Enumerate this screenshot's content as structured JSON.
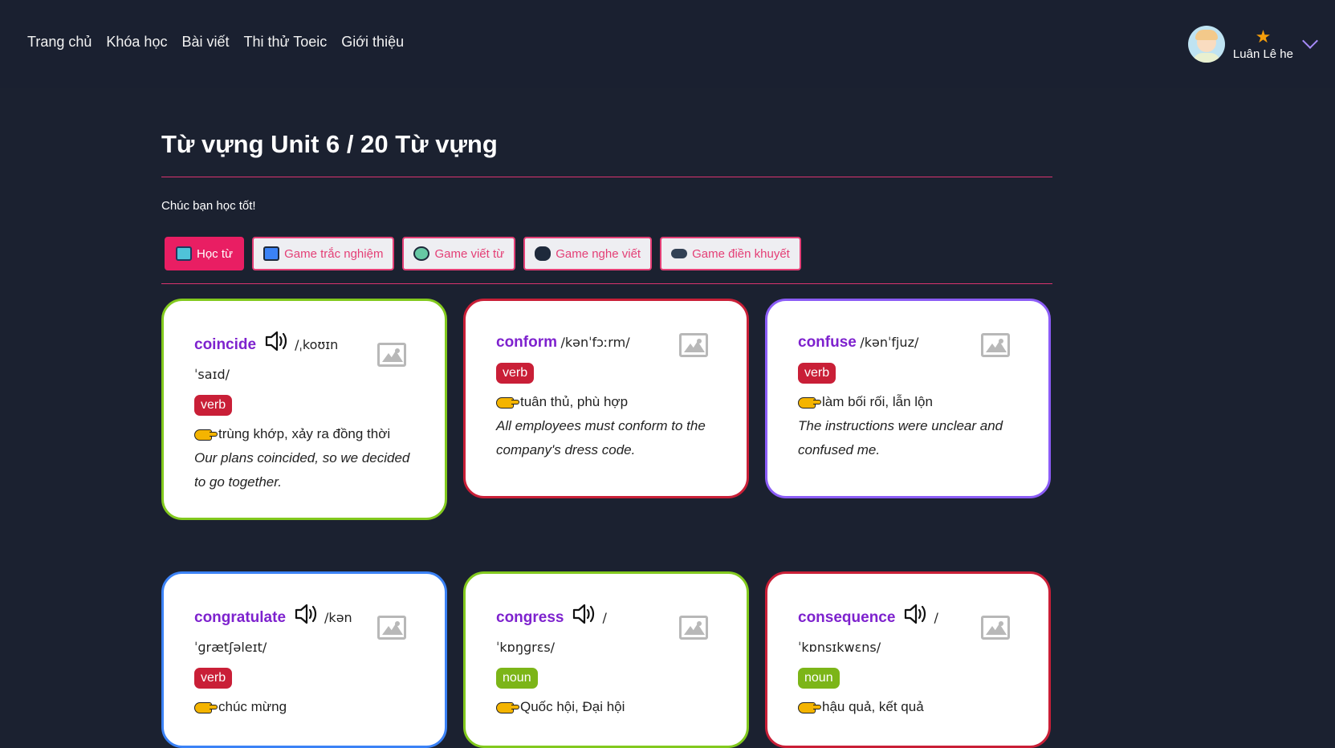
{
  "nav": {
    "items": [
      "Trang chủ",
      "Khóa học",
      "Bài viết",
      "Thi thử Toeic",
      "Giới thiệu"
    ]
  },
  "user": {
    "name": "Luân Lê he"
  },
  "page": {
    "title": "Từ vựng Unit 6 / 20 Từ vựng",
    "subtitle": "Chúc bạn học tốt!"
  },
  "tabs": [
    {
      "label": "Học từ",
      "icon": "book-icon",
      "active": true
    },
    {
      "label": "Game trắc nghiệm",
      "icon": "monitor-icon",
      "active": false
    },
    {
      "label": "Game viết từ",
      "icon": "gamepad-icon",
      "active": false
    },
    {
      "label": "Game nghe viết",
      "icon": "vr-headset-icon",
      "active": false
    },
    {
      "label": "Game điền khuyết",
      "icon": "controller-icon",
      "active": false
    }
  ],
  "cards": [
    {
      "word": "coincide",
      "ipa": "/ˌkoʊɪn ˈsaɪd/",
      "has_audio": true,
      "pos": "verb",
      "meaning": "trùng khớp, xảy ra đồng thời",
      "example": "Our plans coincided, so we decided to go together.",
      "border": "#82c91e"
    },
    {
      "word": "conform",
      "ipa": "/kənˈfɔːrm/",
      "has_audio": false,
      "pos": "verb",
      "meaning": "tuân thủ, phù hợp",
      "example": "All employees must conform to the company's dress code.",
      "border": "#c91f37"
    },
    {
      "word": "confuse",
      "ipa": "/kənˈfjuz/",
      "has_audio": false,
      "pos": "verb",
      "meaning": "làm bối rối, lẫn lộn",
      "example": "The instructions were unclear and confused me.",
      "border": "#8b5cf6"
    },
    {
      "word": "congratulate",
      "ipa": "/kən ˈɡrætʃəleɪt/",
      "has_audio": true,
      "pos": "verb",
      "meaning": "chúc mừng",
      "example": "",
      "border": "#3b82f6"
    },
    {
      "word": "congress",
      "ipa": "/ ˈkɒŋɡrɛs/",
      "has_audio": true,
      "pos": "noun",
      "meaning": "Quốc hội, Đại hội",
      "example": "",
      "border": "#82c91e"
    },
    {
      "word": "consequence",
      "ipa": "/ ˈkɒnsɪkwɛns/",
      "has_audio": true,
      "pos": "noun",
      "meaning": "hậu quả, kết quả",
      "example": "",
      "border": "#c91f37"
    }
  ]
}
